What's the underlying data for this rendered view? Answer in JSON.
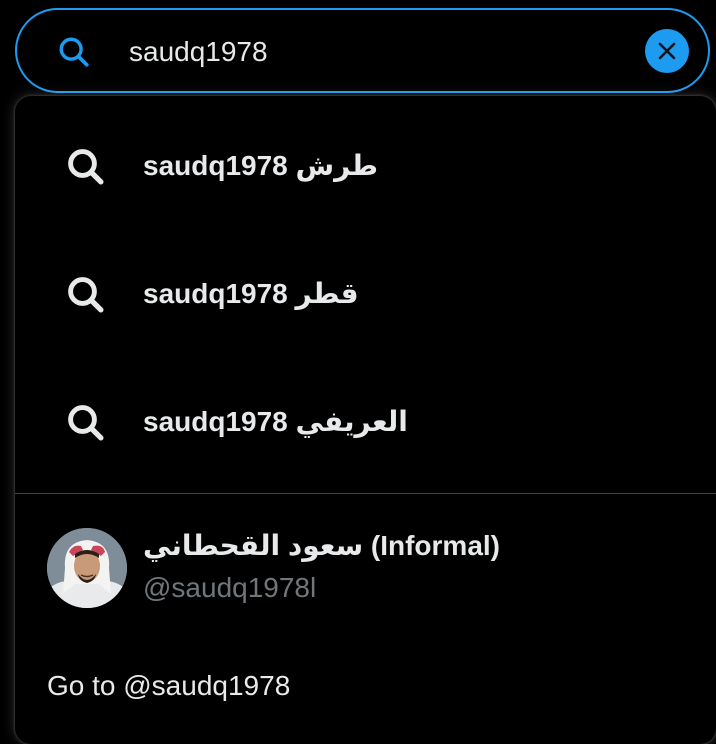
{
  "search": {
    "value": "saudq1978",
    "icon": "search-icon",
    "clear_icon": "close-icon"
  },
  "suggestions": [
    {
      "text": "saudq1978 طرش",
      "icon": "search-icon"
    },
    {
      "text": "saudq1978 قطر",
      "icon": "search-icon"
    },
    {
      "text": "saudq1978 العريفي",
      "icon": "search-icon"
    }
  ],
  "user": {
    "name": "سعود القحطاني (Informal)",
    "handle": "@saudq1978l"
  },
  "goto": {
    "label": "Go to @saudq1978"
  },
  "colors": {
    "accent": "#1d9bf0",
    "background": "#000000",
    "text": "#e7e9ea",
    "muted": "#71767b"
  }
}
